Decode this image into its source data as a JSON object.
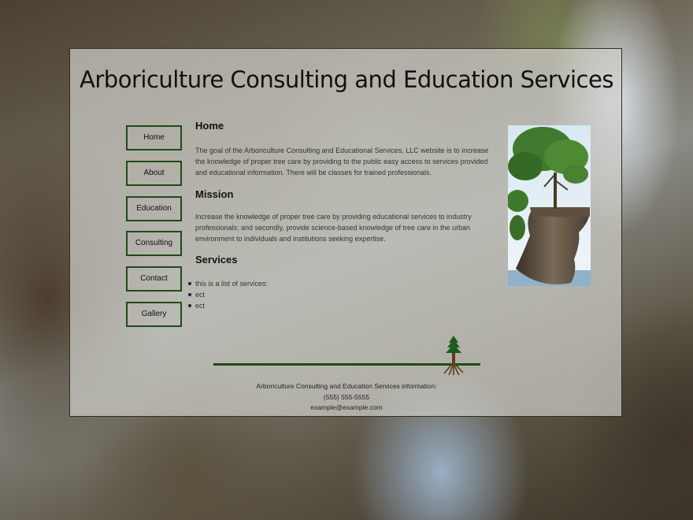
{
  "header": {
    "title": "Arboriculture Consulting and Education Services"
  },
  "nav": {
    "items": [
      {
        "label": "Home"
      },
      {
        "label": "About"
      },
      {
        "label": "Education"
      },
      {
        "label": "Consulting"
      },
      {
        "label": "Contact"
      },
      {
        "label": "Gallery"
      }
    ]
  },
  "main": {
    "home_heading": "Home",
    "home_text": "The goal of the Arboriculture Consulting and Educational Services, LLC website is to increase the knowledge of proper tree care by providing to the public easy access to services provided and educational information. There will be classes for trained professionals.",
    "mission_heading": "Mission",
    "mission_text": "Increase the knowledge of proper tree care by providing educational services to industry professionals; and secondly, provide science-based knowledge of tree care in the urban environment to individuals and institutions seeking expertise.",
    "services_heading": "Services",
    "services": [
      "this is a list of services:",
      "ect",
      "ect"
    ]
  },
  "footer": {
    "info_label": "Arboriculture Consulting and Education Services information:",
    "phone": "(555) 555-5555",
    "email": "example@example.com"
  },
  "colors": {
    "accent": "#1f4a18",
    "panel_border": "#3a2a18"
  }
}
